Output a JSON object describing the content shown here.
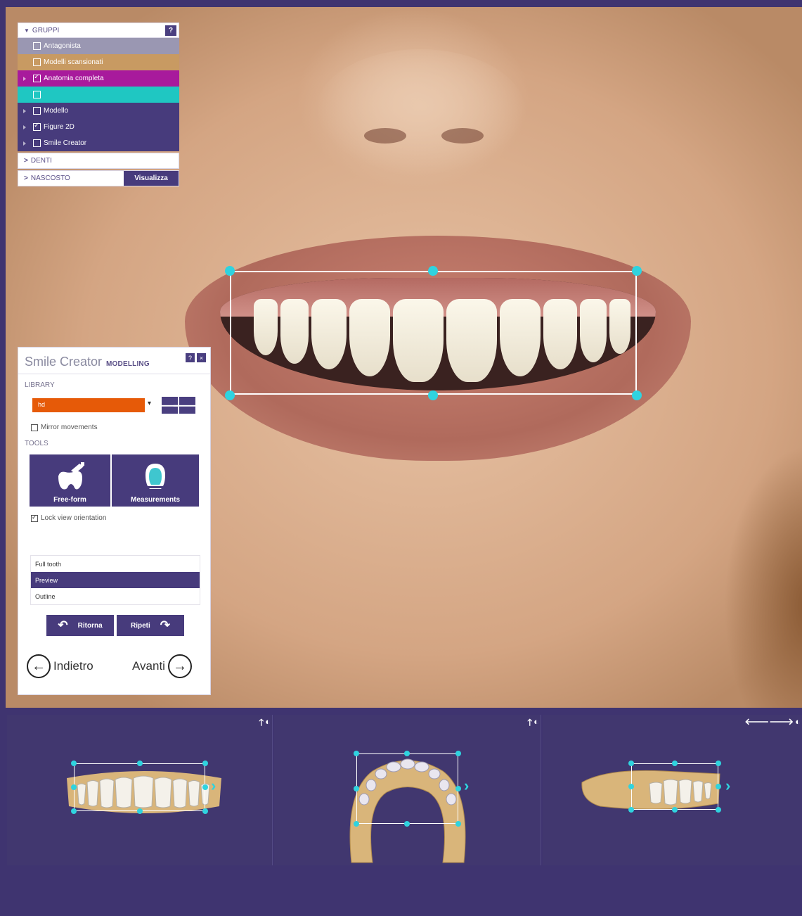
{
  "groups": {
    "header": "GRUPPI",
    "help": "?",
    "items": [
      {
        "label": "Antagonista",
        "color": "#9a97b2",
        "checked": false,
        "expandable": false
      },
      {
        "label": "Modelli scansionati",
        "color": "#c89a62",
        "checked": false,
        "expandable": false
      },
      {
        "label": "Anatomia completa",
        "color": "#a81a9c",
        "checked": true,
        "expandable": true
      },
      {
        "label": "",
        "color": "#1fc7c2",
        "checked": false,
        "expandable": false
      },
      {
        "label": "Modello",
        "color": "#473b7c",
        "checked": false,
        "expandable": true
      },
      {
        "label": "Figure 2D",
        "color": "#473b7c",
        "checked": true,
        "expandable": true
      },
      {
        "label": "Smile Creator",
        "color": "#473b7c",
        "checked": false,
        "expandable": true
      }
    ],
    "denti": "DENTI",
    "nascosto": "NASCOSTO",
    "visualizza": "Visualizza"
  },
  "smile_creator": {
    "title": "Smile Creator",
    "subtitle": "MODELLING",
    "help": "?",
    "close": "×",
    "library_label": "LIBRARY",
    "library_value": "hd",
    "mirror_label": "Mirror movements",
    "mirror_checked": false,
    "tools_label": "TOOLS",
    "tool_freeform": "Free-form",
    "tool_measurements": "Measurements",
    "lock_label": "Lock view orientation",
    "lock_checked": true,
    "view_modes": [
      "Full tooth",
      "Preview",
      "Outline"
    ],
    "view_active": "Preview",
    "undo": "Ritorna",
    "redo": "Ripeti",
    "back": "Indietro",
    "next": "Avanti"
  },
  "colors": {
    "panel_purple": "#473b7c",
    "accent_cyan": "#2fd3df",
    "library_orange": "#e65a08"
  }
}
